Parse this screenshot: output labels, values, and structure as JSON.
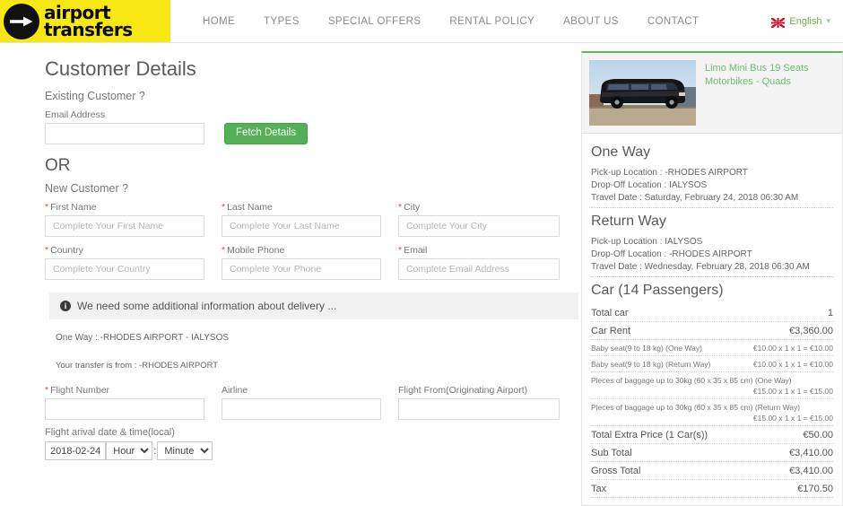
{
  "header": {
    "logo": {
      "line1": "airport",
      "line2": "transfers",
      "icon": "right-arrow-icon"
    },
    "nav": [
      {
        "label": "HOME"
      },
      {
        "label": "TYPES"
      },
      {
        "label": "SPECIAL OFFERS"
      },
      {
        "label": "RENTAL POLICY"
      },
      {
        "label": "ABOUT US"
      },
      {
        "label": "CONTACT"
      }
    ],
    "language": {
      "label": "English",
      "flag": "uk-flag-icon",
      "caret": "chevron-down-icon"
    }
  },
  "main": {
    "title": "Customer Details",
    "existing_customer_label": "Existing Customer ?",
    "email_label": "Email Address",
    "email_value": "",
    "fetch_button": "Fetch Details",
    "or": "OR",
    "new_customer_label": "New Customer ?",
    "fields": [
      {
        "label": "First Name",
        "required": true,
        "placeholder": "Complete Your First Name",
        "value": "",
        "name": "first-name"
      },
      {
        "label": "Last Name",
        "required": true,
        "placeholder": "Complete Your Last Name",
        "value": "",
        "name": "last-name"
      },
      {
        "label": "City",
        "required": true,
        "placeholder": "Complete Your City",
        "value": "",
        "name": "city"
      },
      {
        "label": "Country",
        "required": true,
        "placeholder": "Complete Your Country",
        "value": "",
        "name": "country"
      },
      {
        "label": "Mobile Phone",
        "required": true,
        "placeholder": "Complete Your Phone",
        "value": "",
        "name": "mobile-phone"
      },
      {
        "label": "Email",
        "required": true,
        "placeholder": "Complete Email Address",
        "value": "",
        "name": "email"
      }
    ],
    "notice": "We need some additional information about delivery ...",
    "notice_icon": "info-icon",
    "route_one_way": "One Way : -RHODES AIRPORT - IALYSOS",
    "transfer_from": "Your transfer is from : -RHODES AIRPORT",
    "flight_fields": [
      {
        "label": "Flight Number",
        "required": true,
        "placeholder": "",
        "value": "",
        "name": "flight-number"
      },
      {
        "label": "Airline",
        "required": false,
        "placeholder": "",
        "value": "",
        "name": "airline"
      },
      {
        "label": "Flight From(Originating Airport)",
        "required": false,
        "placeholder": "",
        "value": "",
        "name": "flight-from"
      }
    ],
    "arrival_label": "Flight arival date & time(local)",
    "arrival_date": "2018-02-24",
    "hour_selected": "Hour",
    "minute_selected": "Minute",
    "time_separator": ":"
  },
  "sidebar": {
    "vehicle_title": "Limo Mini Bus 19 Seats Motorbikes - Quads",
    "one_way": {
      "heading": "One Way",
      "pickup": "Pick-up Location : -RHODES AIRPORT",
      "dropoff": "Drop-Off Location : IALYSOS",
      "travel_date": "Travel Date : Saturday, February 24, 2018 06:30 AM"
    },
    "return_way": {
      "heading": "Return Way",
      "pickup": "Pick-up Location : IALYSOS",
      "dropoff": "Drop-Off Location : -RHODES AIRPORT",
      "travel_date": "Travel Date : Wednesday, February 28, 2018 06:30 AM"
    },
    "car_heading": "Car (14 Passengers)",
    "prices": [
      {
        "label": "Total car",
        "value": "1",
        "size": "normal",
        "wrap": false
      },
      {
        "label": "Car Rent",
        "value": "€3,360.00",
        "size": "normal",
        "wrap": false
      },
      {
        "label": "Baby seat(9 to 18 kg) (One Way)",
        "value": "€10.00 x 1 x 1 = €10.00",
        "size": "small",
        "wrap": false
      },
      {
        "label": "Baby seat(9 to 18 kg) (Return Way)",
        "value": "€10.00 x 1 x 1 = €10.00",
        "size": "small",
        "wrap": false
      },
      {
        "label": "Pieces of baggage up to 30kg (60 x 35 x 85 cm) (One Way)",
        "value": "€15.00 x 1 x 1 = €15.00",
        "size": "small",
        "wrap": true
      },
      {
        "label": "Pieces of baggage up to 30kg (60 x 35 x 85 cm) (Return Way)",
        "value": "€15.00 x 1 x 1 = €15.00",
        "size": "small",
        "wrap": true
      },
      {
        "label": "Total Extra Price (1 Car(s))",
        "value": "€50.00",
        "size": "normal",
        "wrap": false
      },
      {
        "label": "Sub Total",
        "value": "€3,410.00",
        "size": "normal",
        "wrap": false
      },
      {
        "label": "Gross Total",
        "value": "€3,410.00",
        "size": "normal",
        "wrap": false
      },
      {
        "label": "Tax",
        "value": "€170.50",
        "size": "normal",
        "wrap": false
      }
    ]
  },
  "colors": {
    "logo_bg": "#f7e713",
    "accent_green": "#5cb85c",
    "button_green": "#54b054",
    "required_red": "#e8463a",
    "nav_text": "#8b8b8b"
  }
}
